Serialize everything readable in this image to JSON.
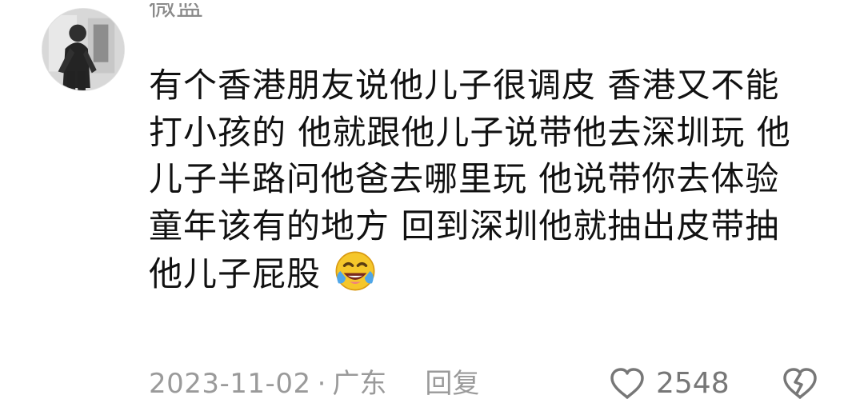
{
  "comment": {
    "username": "微蓝",
    "avatar_icon": "avatar-person-photo",
    "text_lines": [
      "有个香港朋友说他儿子很调皮 香港又不能",
      "打小孩的 他就跟他儿子说带他去深圳玩 他",
      "儿子半路问他爸去哪里玩 他说带你去体验",
      "童年该有的地方 回到深圳他就抽出皮带抽",
      "他儿子屁股"
    ],
    "emoji": "laughing-crying-emoji",
    "date": "2023-11-02",
    "separator": "·",
    "location": "广东",
    "reply_label": "回复",
    "like_count": "2548",
    "like_icon": "heart-outline-icon",
    "dislike_icon": "broken-heart-icon"
  },
  "colors": {
    "text": "#111111",
    "muted": "#9a9a9a",
    "emoji_yellow": "#f5c72b",
    "emoji_blue": "#4fa6e8"
  }
}
